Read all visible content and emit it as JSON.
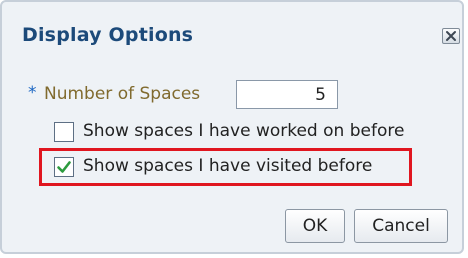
{
  "dialog": {
    "title": "Display Options",
    "close_icon": "close-icon"
  },
  "number_of_spaces": {
    "required_marker": "*",
    "label": "Number of Spaces",
    "value": "5"
  },
  "options": {
    "worked_on": {
      "label": "Show spaces I have worked on before",
      "checked": false
    },
    "visited": {
      "label": "Show spaces I have visited before",
      "checked": true
    }
  },
  "buttons": {
    "ok_label": "OK",
    "cancel_label": "Cancel"
  },
  "colors": {
    "title": "#1c4a7a",
    "field_label": "#806a2e",
    "required_star": "#1a65c2",
    "highlight_border": "#e0161f",
    "dialog_background": "#eef2f6"
  }
}
